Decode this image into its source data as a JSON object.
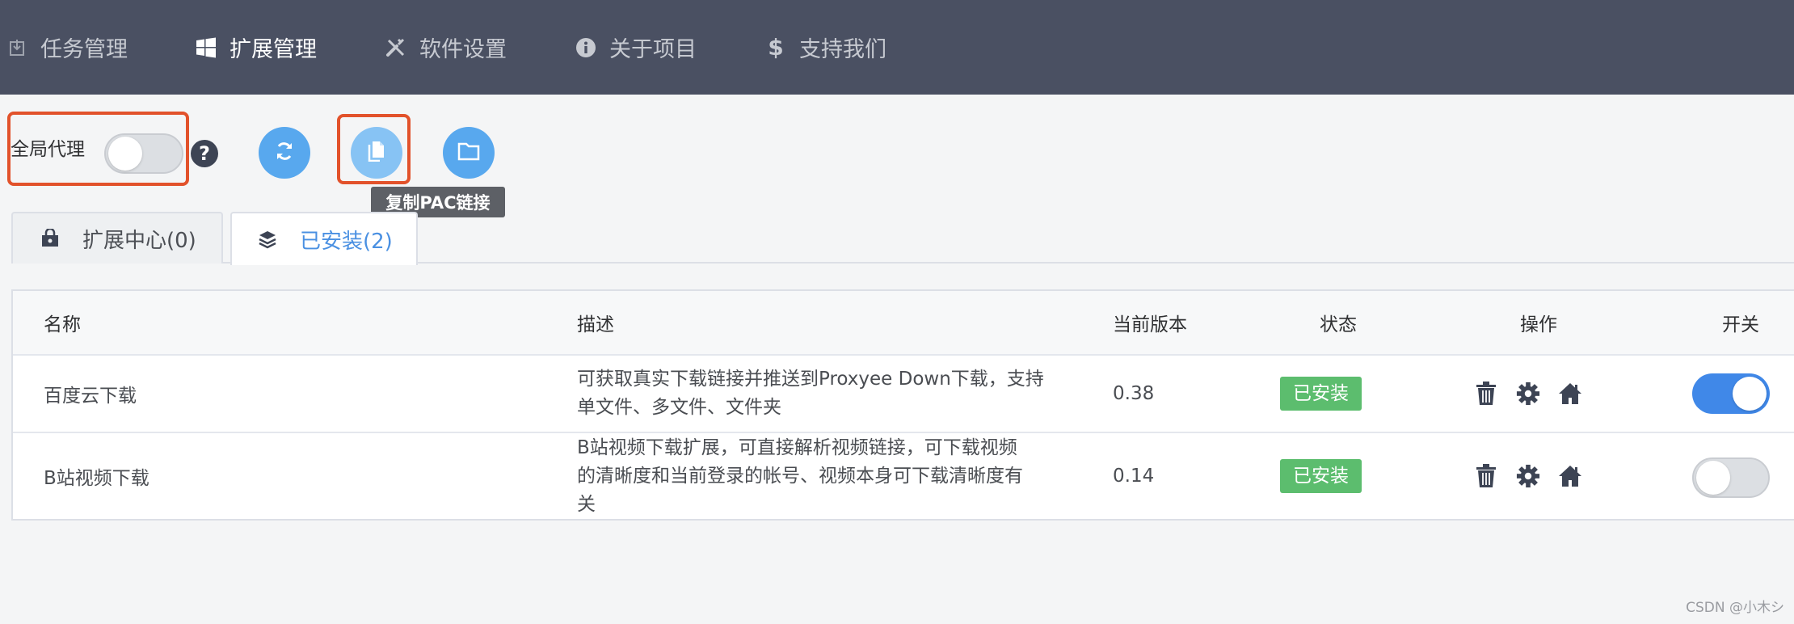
{
  "nav": {
    "items": [
      {
        "label": "任务管理",
        "icon": "download-icon",
        "active": false
      },
      {
        "label": "扩展管理",
        "icon": "windows-icon",
        "active": true
      },
      {
        "label": "软件设置",
        "icon": "tools-icon",
        "active": false
      },
      {
        "label": "关于项目",
        "icon": "info-icon",
        "active": false
      },
      {
        "label": "支持我们",
        "icon": "dollar-icon",
        "active": false
      }
    ]
  },
  "toolbar": {
    "global_proxy_label": "全局代理",
    "global_proxy_on": false,
    "help_glyph": "?",
    "buttons": [
      {
        "icon": "refresh-icon"
      },
      {
        "icon": "copy-icon"
      },
      {
        "icon": "folder-icon"
      }
    ],
    "tooltip": "复制PAC链接"
  },
  "tabs": [
    {
      "label": "扩展中心(0)",
      "icon": "shopping-bag-icon",
      "active": false
    },
    {
      "label": "已安装(2)",
      "icon": "layers-icon",
      "active": true
    }
  ],
  "table": {
    "headers": {
      "name": "名称",
      "desc": "描述",
      "version": "当前版本",
      "status": "状态",
      "ops": "操作",
      "switch": "开关"
    },
    "rows": [
      {
        "name": "百度云下载",
        "desc": [
          "可获取真实下载链接并推送到Proxyee Down下载，支持",
          "单文件、多文件、文件夹"
        ],
        "version": "0.38",
        "status": "已安装",
        "enabled": true
      },
      {
        "name": "B站视频下载",
        "desc": [
          "B站视频下载扩展，可直接解析视频链接，可下载视频",
          "的清晰度和当前登录的帐号、视频本身可下载清晰度有",
          "关"
        ],
        "version": "0.14",
        "status": "已安装",
        "enabled": false
      }
    ]
  },
  "colors": {
    "nav_bg": "#4a5062",
    "accent": "#4a90e2",
    "badge": "#5cbd6e",
    "highlight": "#e2522b"
  },
  "watermark": "CSDN @小木シ"
}
